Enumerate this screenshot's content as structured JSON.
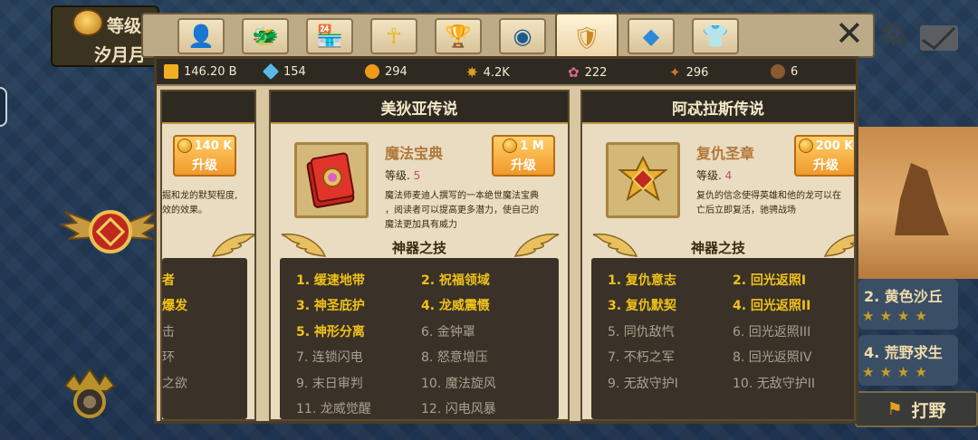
{
  "background": {
    "player": {
      "level_label": "等级",
      "name": "汐月月"
    },
    "map_entries": [
      {
        "label": "2. 黄色沙丘",
        "stars": "★★★★"
      },
      {
        "label": "4. 荒野求生",
        "stars": "★★★★"
      }
    ],
    "hunt_button": {
      "label": "打野"
    }
  },
  "tabs": [
    {
      "icon": "person-icon",
      "glyph": "👤",
      "color": "#f0b818"
    },
    {
      "icon": "dragon-head-icon",
      "glyph": "🐲",
      "color": "#d8a028"
    },
    {
      "icon": "shop-icon",
      "glyph": "🏪",
      "color": "#e0b030"
    },
    {
      "icon": "ankh-icon",
      "glyph": "☥",
      "color": "#e8b820"
    },
    {
      "icon": "trophy-icon",
      "glyph": "🏆",
      "color": "#e0a818"
    },
    {
      "icon": "orb-icon",
      "glyph": "◉",
      "color": "#1a5a90"
    },
    {
      "icon": "artifact-icon",
      "glyph": "🛡",
      "color": "#c88a20",
      "active": true
    },
    {
      "icon": "diamond-icon",
      "glyph": "◆",
      "color": "#2a8ad8"
    },
    {
      "icon": "shirt-icon",
      "glyph": "👕",
      "color": "#9878c8"
    }
  ],
  "resources": [
    {
      "icon": "gold-bars-icon",
      "value": "146.20 B",
      "color": "#f0b020"
    },
    {
      "icon": "diamond-icon",
      "value": "154",
      "color": "#5ab8e8"
    },
    {
      "icon": "gold-coin-icon",
      "value": "294",
      "color": "#f09a1a"
    },
    {
      "icon": "star-badge-icon",
      "value": "4.2K",
      "color": "#e0a020"
    },
    {
      "icon": "flower-icon",
      "value": "222",
      "color": "#e06a8a"
    },
    {
      "icon": "crest-icon",
      "value": "296",
      "color": "#d07830"
    },
    {
      "icon": "acorn-icon",
      "value": "6",
      "color": "#8a5a30"
    }
  ],
  "columns": [
    {
      "header": "",
      "item": {
        "name": "",
        "level_label": "",
        "level": "",
        "desc_lines": [
          "掘和龙的默契程度,",
          "效的效果。"
        ]
      },
      "upgrade": {
        "cost": "140 K",
        "label": "升级"
      },
      "skills_title": "",
      "skills": [
        {
          "text": "者",
          "on": true
        },
        {
          "text": "爆发",
          "on": true
        },
        {
          "text": "击",
          "on": false
        },
        {
          "text": "环",
          "on": false
        },
        {
          "text": "之欲",
          "on": false
        },
        {
          "text": "",
          "on": false
        }
      ]
    },
    {
      "header": "美狄亚传说",
      "item": {
        "name": "魔法宝典",
        "level_label": "等级.",
        "level": "5",
        "desc_lines": [
          "魔法师麦迪人撰写的一本绝世魔法宝典",
          "，阅读者可以提高更多潜力，使自己的",
          "魔法更加具有威力"
        ]
      },
      "upgrade": {
        "cost": "1 M",
        "label": "升级"
      },
      "skills_title": "神器之技",
      "skills": [
        {
          "text": "1. 缓速地带",
          "on": true
        },
        {
          "text": "2. 祝福领域",
          "on": true
        },
        {
          "text": "3. 神圣庇护",
          "on": true
        },
        {
          "text": "4. 龙威震慑",
          "on": true
        },
        {
          "text": "5. 神形分离",
          "on": true
        },
        {
          "text": "6. 金钟罩",
          "on": false
        },
        {
          "text": "7. 连锁闪电",
          "on": false
        },
        {
          "text": "8. 怒意增压",
          "on": false
        },
        {
          "text": "9. 末日审判",
          "on": false
        },
        {
          "text": "10. 魔法旋风",
          "on": false
        },
        {
          "text": "11. 龙威觉醒",
          "on": false
        },
        {
          "text": "12. 闪电风暴",
          "on": false
        }
      ]
    },
    {
      "header": "阿忒拉斯传说",
      "item": {
        "name": "复仇圣章",
        "level_label": "等级.",
        "level": "4",
        "desc_lines": [
          "复仇的信念使得英雄和他的龙可以在",
          "亡后立即复活，驰骋战场"
        ]
      },
      "upgrade": {
        "cost": "200 K",
        "label": "升级"
      },
      "skills_title": "神器之技",
      "skills": [
        {
          "text": "1. 复仇意志",
          "on": true
        },
        {
          "text": "2. 回光返照I",
          "on": true
        },
        {
          "text": "3. 复仇默契",
          "on": true
        },
        {
          "text": "4. 回光返照II",
          "on": true
        },
        {
          "text": "5. 同仇敌忾",
          "on": false
        },
        {
          "text": "6. 回光返照III",
          "on": false
        },
        {
          "text": "7. 不朽之军",
          "on": false
        },
        {
          "text": "8. 回光返照IV",
          "on": false
        },
        {
          "text": "9. 无敌守护I",
          "on": false
        },
        {
          "text": "10. 无敌守护II",
          "on": false
        }
      ]
    }
  ]
}
